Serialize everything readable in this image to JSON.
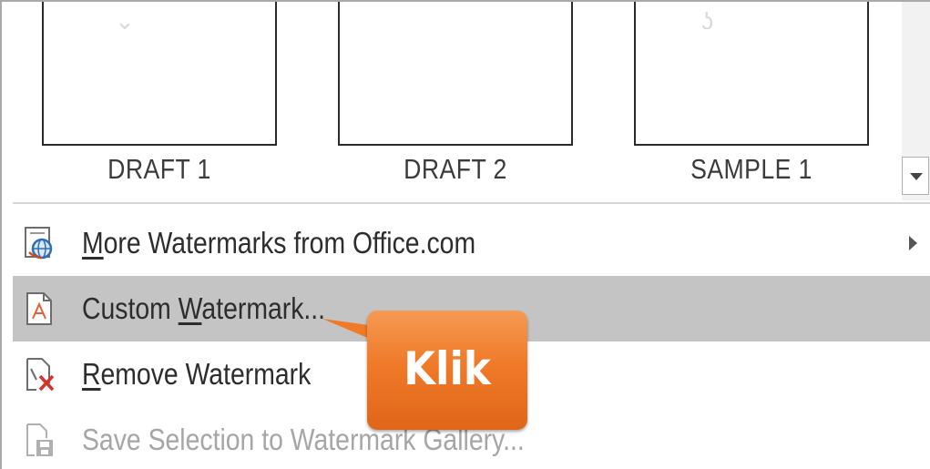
{
  "gallery": {
    "items": [
      {
        "label": "DRAFT 1"
      },
      {
        "label": "DRAFT 2"
      },
      {
        "label": "SAMPLE 1"
      }
    ],
    "scroll_icon": "chevron-down-icon"
  },
  "menu": {
    "more": {
      "pre": "",
      "acc": "M",
      "post": "ore Watermarks from Office.com",
      "icon": "globe-doc-icon",
      "has_submenu": true
    },
    "custom": {
      "pre": "Custom ",
      "acc": "W",
      "post": "atermark...",
      "icon": "pdf-doc-icon",
      "highlighted": true
    },
    "remove": {
      "pre": "",
      "acc": "R",
      "post": "emove Watermark",
      "icon": "doc-remove-icon"
    },
    "save": {
      "pre": "",
      "acc": "",
      "post": "Save Selection to Watermark Gallery...",
      "icon": "doc-save-icon",
      "disabled": true
    }
  },
  "callout": {
    "text": "Klik",
    "color": "#ef7a28"
  },
  "colors": {
    "highlight": "#c4c4c4",
    "callout": "#ef7a28",
    "disabled_text": "#a6a6a6"
  }
}
